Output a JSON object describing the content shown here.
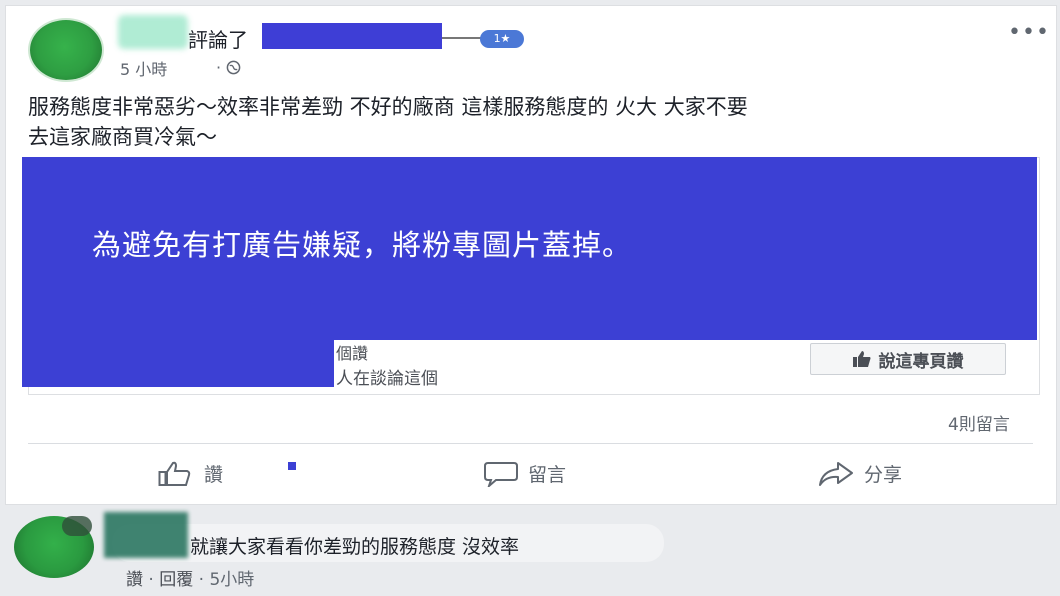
{
  "post": {
    "action_text": "評論了",
    "badge": "1★",
    "time": "5 小時",
    "globe_icon": "globe-icon",
    "more": "•••",
    "text_line1": "服務態度非常惡劣～效率非常差勁 不好的廠商 這樣服務態度的 火大 大家不要",
    "text_line2": "去這家廠商買冷氣～"
  },
  "page_card": {
    "cover_message": "為避免有打廣告嫌疑，將粉專圖片蓋掉。",
    "likes_text": "個讚",
    "talking_text": "人在談論這個",
    "like_page_label": "說這專頁讚",
    "redact_color": "#3c40d4"
  },
  "stats": {
    "comments": "4則留言"
  },
  "actions": {
    "like": "讚",
    "comment": "留言",
    "share": "分享"
  },
  "comment": {
    "text": "就讓大家看看你差勁的服務態度 沒效率",
    "like": "讚",
    "reply": "回覆",
    "time": "5小時",
    "sep": "·"
  }
}
